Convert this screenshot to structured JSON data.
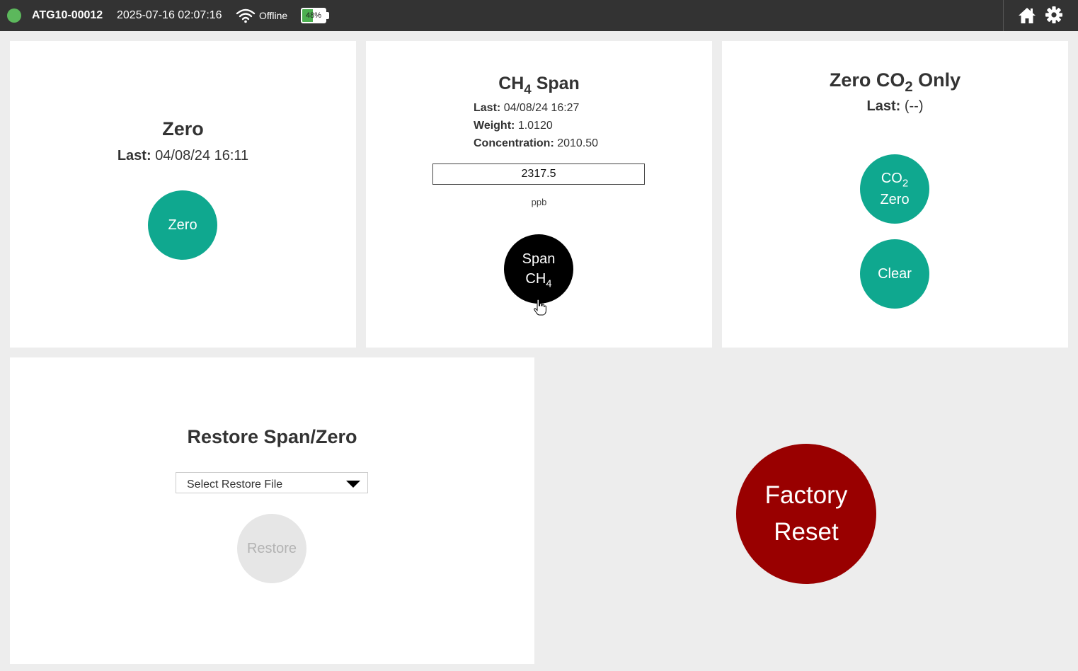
{
  "topbar": {
    "device_id": "ATG10-00012",
    "datetime": "2025-07-16 02:07:16",
    "network_status": "Offline",
    "battery_label": "48%",
    "battery_level": 0.48,
    "status_color": "#5cb85c",
    "icons": [
      "status-dot",
      "wifi-icon",
      "battery-icon",
      "home-icon",
      "gear-icon"
    ]
  },
  "zero_panel": {
    "title": "Zero",
    "last_label": "Last:",
    "last_value": "04/08/24 16:11",
    "button_label": "Zero"
  },
  "span_panel": {
    "title_main": "CH",
    "title_sub": "4",
    "title_suffix": "Span",
    "last_label": "Last:",
    "last_value": "04/08/24 16:27",
    "weight_label": "Weight:",
    "weight_value": "1.0120",
    "concentration_label": "Concentration:",
    "concentration_value": "2010.50",
    "input_value": "2317.5",
    "unit": "ppb",
    "button_line1": "Span",
    "button_line2_main": "CH",
    "button_line2_sub": "4"
  },
  "co2_panel": {
    "title_prefix": "Zero CO",
    "title_sub": "2",
    "title_suffix": "Only",
    "last_label": "Last:",
    "last_value": "(--)",
    "zero_button_line1_main": "CO",
    "zero_button_line1_sub": "2",
    "zero_button_line2": "Zero",
    "clear_button_label": "Clear"
  },
  "restore_panel": {
    "title": "Restore Span/Zero",
    "select_placeholder": "Select Restore File",
    "button_label": "Restore"
  },
  "factory_reset": {
    "line1": "Factory",
    "line2": "Reset"
  },
  "colors": {
    "topbar": "#333333",
    "teal": "#0fa88f",
    "span_button": "#000000",
    "factory_reset": "#990000",
    "restore_disabled": "#e6e6e6",
    "battery_fill": "#4caf50"
  }
}
